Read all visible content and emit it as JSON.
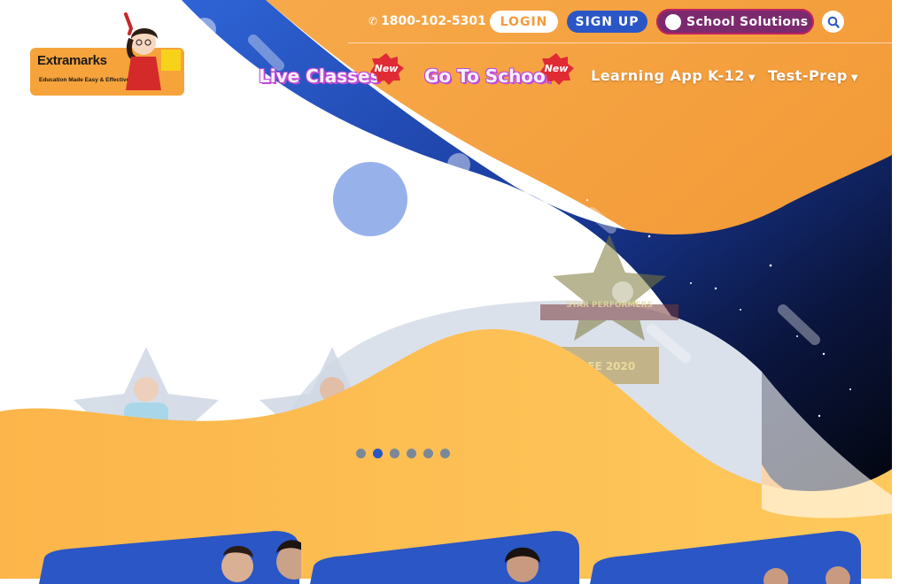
{
  "brand": {
    "name": "Extramarks",
    "tagline": "Education Made Easy & Effective"
  },
  "topbar": {
    "phone": "1800-102-5301",
    "login_label": "LOGIN",
    "signup_label": "SIGN UP",
    "school_solutions_label": "School Solutions"
  },
  "nav": {
    "live_classes": "Live Classes",
    "go_to_school": "Go To School",
    "new_badge": "New",
    "learning_app": "Learning App",
    "k12": "K-12",
    "test_prep": "Test-Prep"
  },
  "hero": {
    "trophy_title": "STAR PERFORMERS",
    "trophy_year": "JEE 2020",
    "slide_count": 6,
    "active_slide": 2
  },
  "icons": {
    "phone": "phone-icon",
    "search": "search-icon",
    "caret": "caret-down-icon"
  },
  "colors": {
    "orange": "#f59a3b",
    "blue": "#2a56c6",
    "navy": "#0d1d4a",
    "yellow": "#fdbf4d",
    "purple": "#7c2a6e"
  }
}
